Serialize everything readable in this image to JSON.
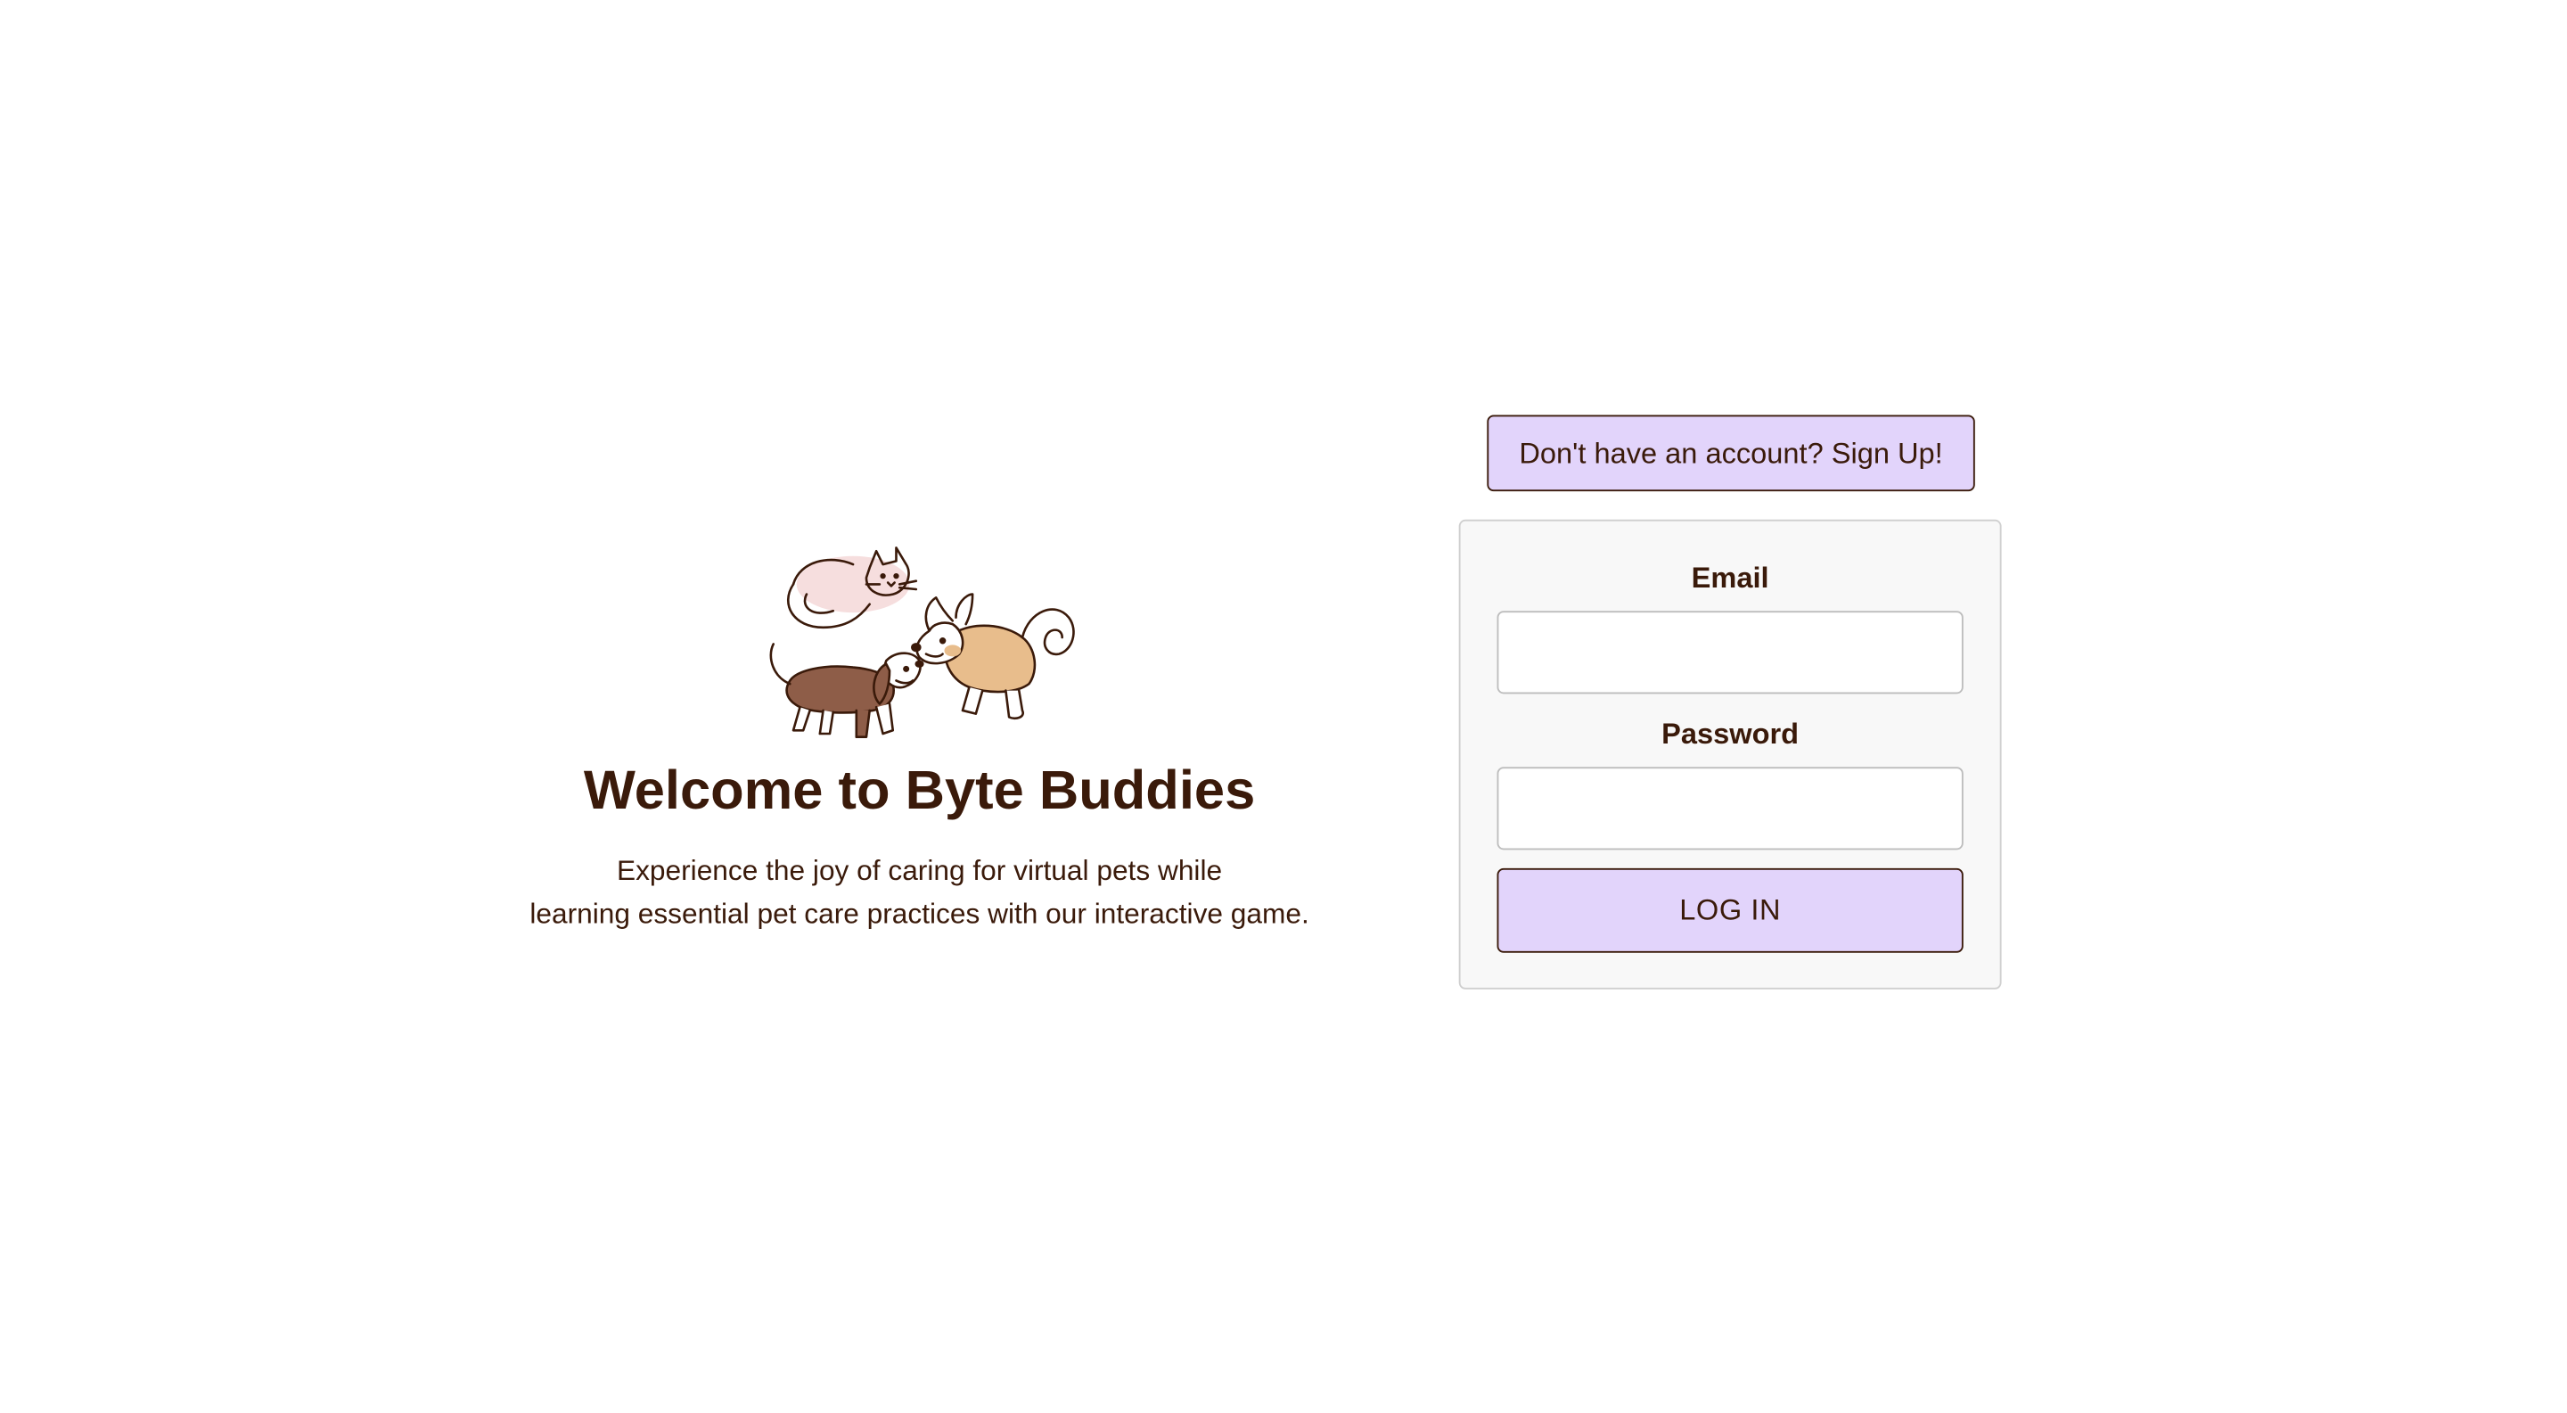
{
  "hero": {
    "title": "Welcome to Byte Buddies",
    "description_line1": "Experience the joy of caring for virtual pets while",
    "description_line2": "learning essential pet care practices with our interactive game."
  },
  "auth": {
    "signup_label": "Don't have an account? Sign Up!",
    "email_label": "Email",
    "email_value": "",
    "password_label": "Password",
    "password_value": "",
    "login_label": "LOG IN"
  },
  "colors": {
    "text": "#3a1a0a",
    "accent": "#e2d4fb",
    "card_bg": "#f8f8f8"
  },
  "icons": [
    "pets-illustration-icon"
  ]
}
